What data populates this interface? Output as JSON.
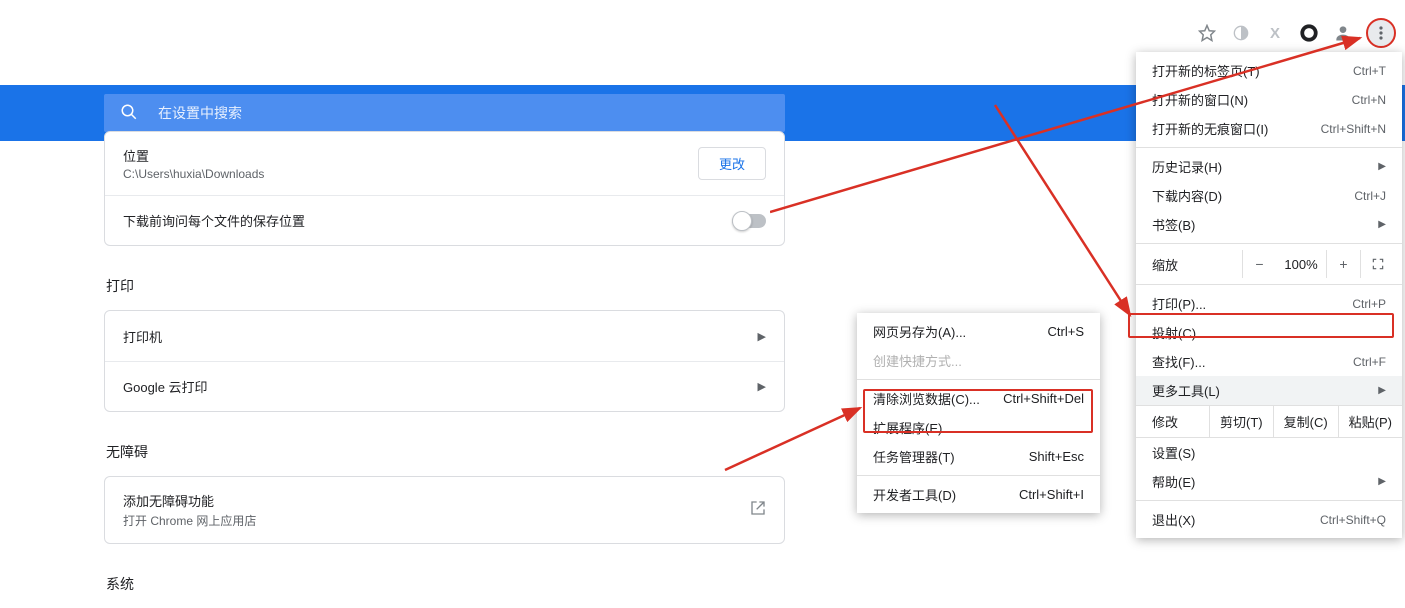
{
  "toolbar": {},
  "search": {
    "placeholder": "在设置中搜索"
  },
  "download": {
    "location_label": "位置",
    "location_value": "C:\\Users\\huxia\\Downloads",
    "change_btn": "更改",
    "ask_label": "下载前询问每个文件的保存位置"
  },
  "print": {
    "header": "打印",
    "printer": "打印机",
    "cloud": "Google 云打印"
  },
  "accessibility": {
    "header": "无障碍",
    "add": "添加无障碍功能",
    "sub": "打开 Chrome 网上应用店"
  },
  "system": {
    "header": "系统"
  },
  "menu": {
    "new_tab": "打开新的标签页(T)",
    "new_tab_sc": "Ctrl+T",
    "new_window": "打开新的窗口(N)",
    "new_window_sc": "Ctrl+N",
    "incognito": "打开新的无痕窗口(I)",
    "incognito_sc": "Ctrl+Shift+N",
    "history": "历史记录(H)",
    "downloads": "下载内容(D)",
    "downloads_sc": "Ctrl+J",
    "bookmarks": "书签(B)",
    "zoom_label": "缩放",
    "zoom_value": "100%",
    "print": "打印(P)...",
    "print_sc": "Ctrl+P",
    "cast": "投射(C)...",
    "find": "查找(F)...",
    "find_sc": "Ctrl+F",
    "more_tools": "更多工具(L)",
    "edit": "修改",
    "cut": "剪切(T)",
    "copy": "复制(C)",
    "paste": "粘贴(P)",
    "settings": "设置(S)",
    "help": "帮助(E)",
    "quit": "退出(X)",
    "quit_sc": "Ctrl+Shift+Q"
  },
  "submenu": {
    "save_as": "网页另存为(A)...",
    "save_as_sc": "Ctrl+S",
    "create_shortcut": "创建快捷方式...",
    "clear_data": "清除浏览数据(C)...",
    "clear_data_sc": "Ctrl+Shift+Del",
    "extensions": "扩展程序(E)",
    "task_mgr": "任务管理器(T)",
    "task_mgr_sc": "Shift+Esc",
    "dev_tools": "开发者工具(D)",
    "dev_tools_sc": "Ctrl+Shift+I"
  }
}
